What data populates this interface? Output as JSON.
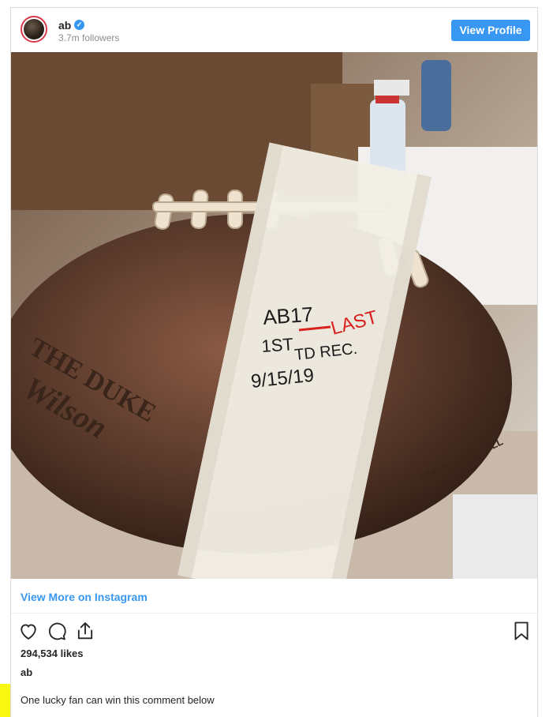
{
  "post": {
    "username": "ab",
    "verified_glyph": "✓",
    "followers": "3.7m followers",
    "view_profile_label": "View Profile",
    "view_more_label": "View More on Instagram",
    "likes": "294,534 likes",
    "caption_user": "ab",
    "caption_text": "One lucky fan can win this comment below"
  },
  "photo": {
    "tape_lines": [
      "AB17",
      "1ST",
      "TD REC.",
      "9/15/19"
    ],
    "annotation": "LAST",
    "ball_text_left": "THE DUKE",
    "ball_brand": "Wilson",
    "ball_text_right": "ROGER GOODELL"
  },
  "icons": {
    "like": "heart-icon",
    "comment": "comment-bubble-icon",
    "share": "share-icon",
    "save": "bookmark-icon",
    "verified": "verified-badge-icon"
  },
  "colors": {
    "accent": "#3897f0",
    "highlight": "#f7f711",
    "annotation_red": "#d9221f",
    "avatar_ring": "#d93a4a"
  }
}
